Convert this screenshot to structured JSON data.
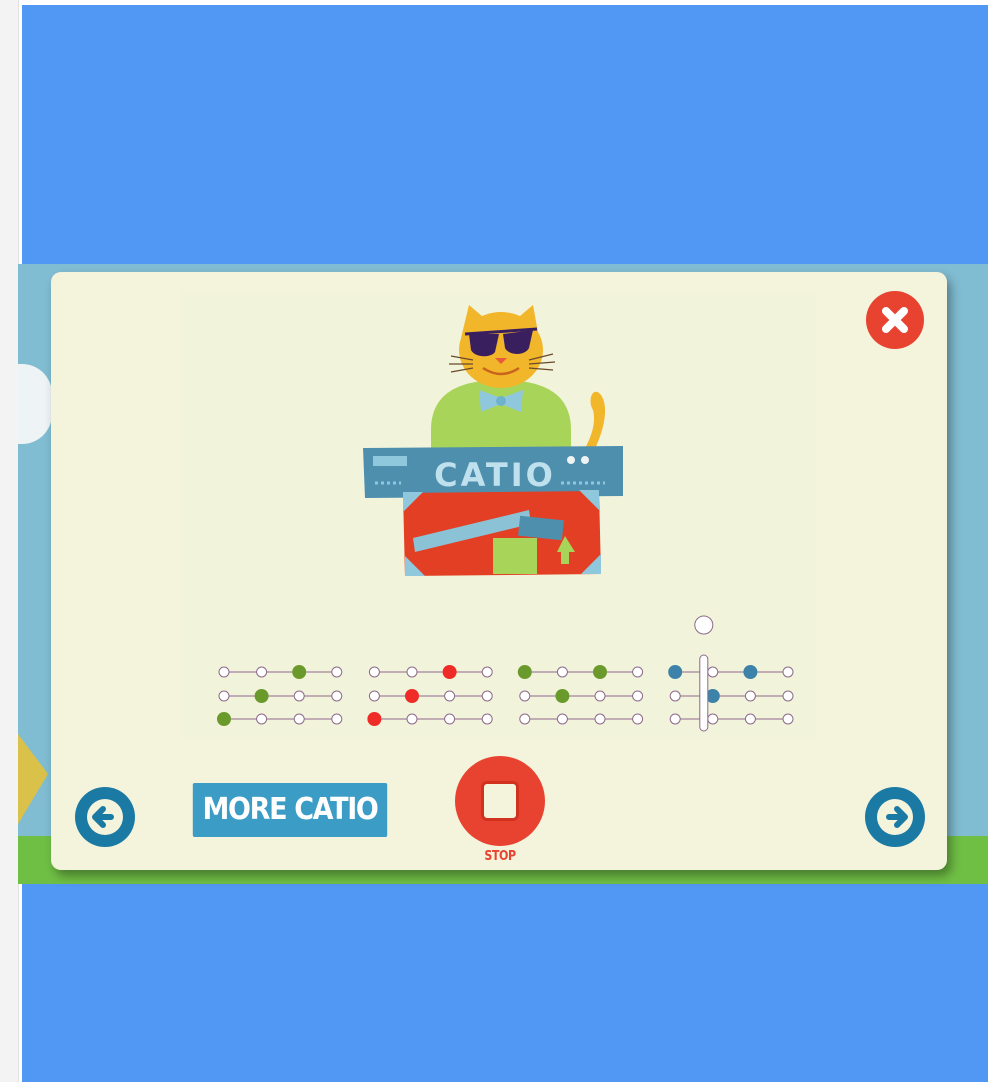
{
  "modal": {
    "more_button_label": "MORE CATIO",
    "stop_label": "STOP",
    "instrument_label": "CATIO"
  },
  "colors": {
    "background_blue": "#5197f4",
    "scene_blue": "#80bcd2",
    "modal_bg": "#f4f3dc",
    "accent_red": "#e84330",
    "nav_blue": "#1b7aa4",
    "more_button_blue": "#3b9cc6",
    "note_green": "#6b9a2c",
    "note_red": "#ee2b26",
    "note_blue": "#3d82a8"
  },
  "icons": {
    "close": "close-x-icon",
    "prev": "arrow-left-icon",
    "next": "arrow-right-icon",
    "stop": "stop-square-icon",
    "playhead": "playhead-icon"
  },
  "sequencer": {
    "playhead_step": 13,
    "rows": [
      [
        "o",
        "o",
        "green",
        "o",
        "o",
        "o",
        "red",
        "o",
        "green",
        "o",
        "green",
        "o",
        "blue",
        "o",
        "blue",
        "o"
      ],
      [
        "o",
        "green",
        "o",
        "o",
        "o",
        "red",
        "o",
        "o",
        "o",
        "green",
        "o",
        "o",
        "o",
        "blue",
        "o",
        "o"
      ],
      [
        "green",
        "o",
        "o",
        "o",
        "red",
        "o",
        "o",
        "o",
        "o",
        "o",
        "o",
        "o",
        "o",
        "o",
        "o",
        "o"
      ]
    ]
  }
}
